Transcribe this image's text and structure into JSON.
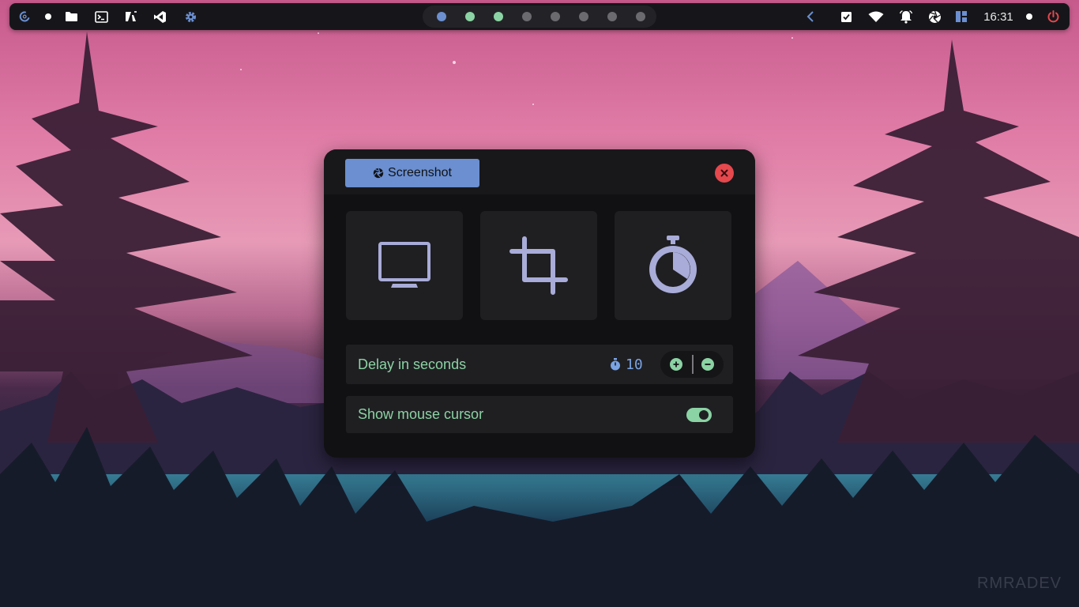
{
  "desktop": {
    "watermark": "RMRADEV"
  },
  "topbar": {
    "left_icons": [
      "debian-logo-icon",
      "dot-icon",
      "folder-icon",
      "terminal-icon",
      "code-editor-icon",
      "vscode-icon",
      "settings-gear-icon"
    ],
    "workspaces": [
      {
        "state": "active",
        "color": "#6b8fd0"
      },
      {
        "state": "occupied",
        "color": "#8bd3a4"
      },
      {
        "state": "occupied",
        "color": "#8bd3a4"
      },
      {
        "state": "empty",
        "color": "#6b6b6f"
      },
      {
        "state": "empty",
        "color": "#6b6b6f"
      },
      {
        "state": "empty",
        "color": "#6b6b6f"
      },
      {
        "state": "empty",
        "color": "#6b6b6f"
      },
      {
        "state": "empty",
        "color": "#6b6b6f"
      }
    ],
    "right_icons": [
      "chevron-left-icon",
      "clipboard-check-icon",
      "wifi-icon",
      "notification-bell-icon",
      "camera-aperture-icon",
      "layout-icon"
    ],
    "clock": "16:31",
    "power_icon": "power-icon"
  },
  "dialog": {
    "title": "Screenshot",
    "title_icon": "camera-aperture-icon",
    "modes": [
      {
        "name": "fullscreen",
        "icon": "monitor-icon"
      },
      {
        "name": "area-select",
        "icon": "crop-icon"
      },
      {
        "name": "timer",
        "icon": "stopwatch-icon"
      }
    ],
    "delay": {
      "label": "Delay in seconds",
      "value": "10",
      "increase_icon": "plus-circle-icon",
      "decrease_icon": "minus-circle-icon"
    },
    "cursor": {
      "label": "Show mouse cursor",
      "enabled": true
    }
  },
  "colors": {
    "accent_blue": "#6b8fd0",
    "accent_green": "#8bd3a4",
    "close_red": "#e5484d",
    "icon_lavender": "#a9acd8",
    "dialog_bg": "#111113",
    "tile_bg": "#1f1f22"
  }
}
